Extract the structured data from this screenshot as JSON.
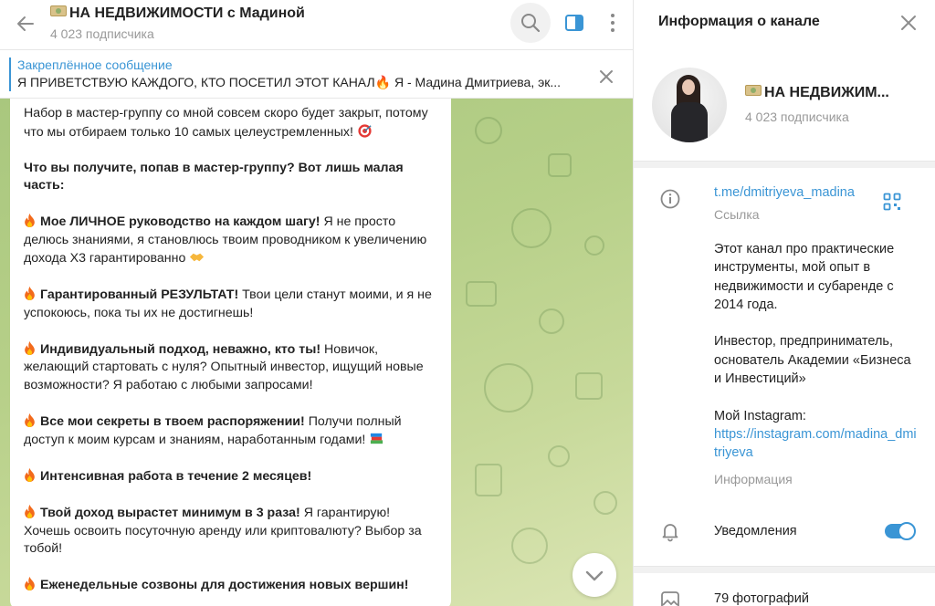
{
  "chat_header": {
    "title": "НА НЕДВИЖИМОСТИ с Мадиной",
    "subscribers": "4 023 подписчика"
  },
  "pinned": {
    "title": "Закреплённое сообщение",
    "text": "Я ПРИВЕТСТВУЮ КАЖДОГО, КТО ПОСЕТИЛ ЭТОТ КАНАЛ🔥  Я - Мадина Дмитриева, эк..."
  },
  "message": {
    "intro": "Набор в мастер-группу со мной совсем скоро будет закрыт, потому что мы отбираем только 10 самых целеустремленных!",
    "question": "Что вы получите, попав в мастер-группу? Вот лишь малая часть:",
    "items": [
      {
        "bold": "Мое ЛИЧНОЕ руководство на каждом шагу!",
        "text": " Я не просто делюсь знаниями, я становлюсь твоим проводником к увеличению дохода Х3 гарантированно"
      },
      {
        "bold": "Гарантированный РЕЗУЛЬТАТ!",
        "text": " Твои цели станут моими, и я не успокоюсь, пока ты их не достигнешь!"
      },
      {
        "bold": "Индивидуальный подход, неважно, кто ты!",
        "text": " Новичок, желающий стартовать с нуля? Опытный инвестор, ищущий новые возможности? Я работаю с любыми запросами!"
      },
      {
        "bold": "Все мои секреты в твоем распоряжении!",
        "text": " Получи полный доступ к моим курсам и знаниям, наработанным годами!"
      },
      {
        "bold": "Интенсивная работа в течение 2 месяцев!",
        "text": ""
      },
      {
        "bold": "Твой доход вырастет минимум в 3 раза!",
        "text": " Я гарантирую! Хочешь освоить посуточную аренду или криптовалюту? Выбор за тобой!"
      },
      {
        "bold": "Еженедельные созвоны для достижения новых вершин!",
        "text": ""
      }
    ]
  },
  "info": {
    "title": "Информация о канале",
    "name": "НА НЕДВИЖИМ...",
    "subscribers": "4 023 подписчика",
    "link": "t.me/dmitriyeva_madina",
    "link_label": "Ссылка",
    "desc_p1": "Этот канал про практические инструменты, мой опыт в недвижимости и субаренде с 2014 года.",
    "desc_p2": "Инвестор, предприниматель, основатель Академии «Бизнеса и Инвестиций»",
    "desc_p3": "Мой Instagram:",
    "instagram": "https://instagram.com/madina_dmitriyeva",
    "desc_label": "Информация",
    "notifications": "Уведомления",
    "photos": "79 фотографий"
  },
  "colors": {
    "accent": "#3a95d5",
    "fire": "#f26a1b"
  }
}
